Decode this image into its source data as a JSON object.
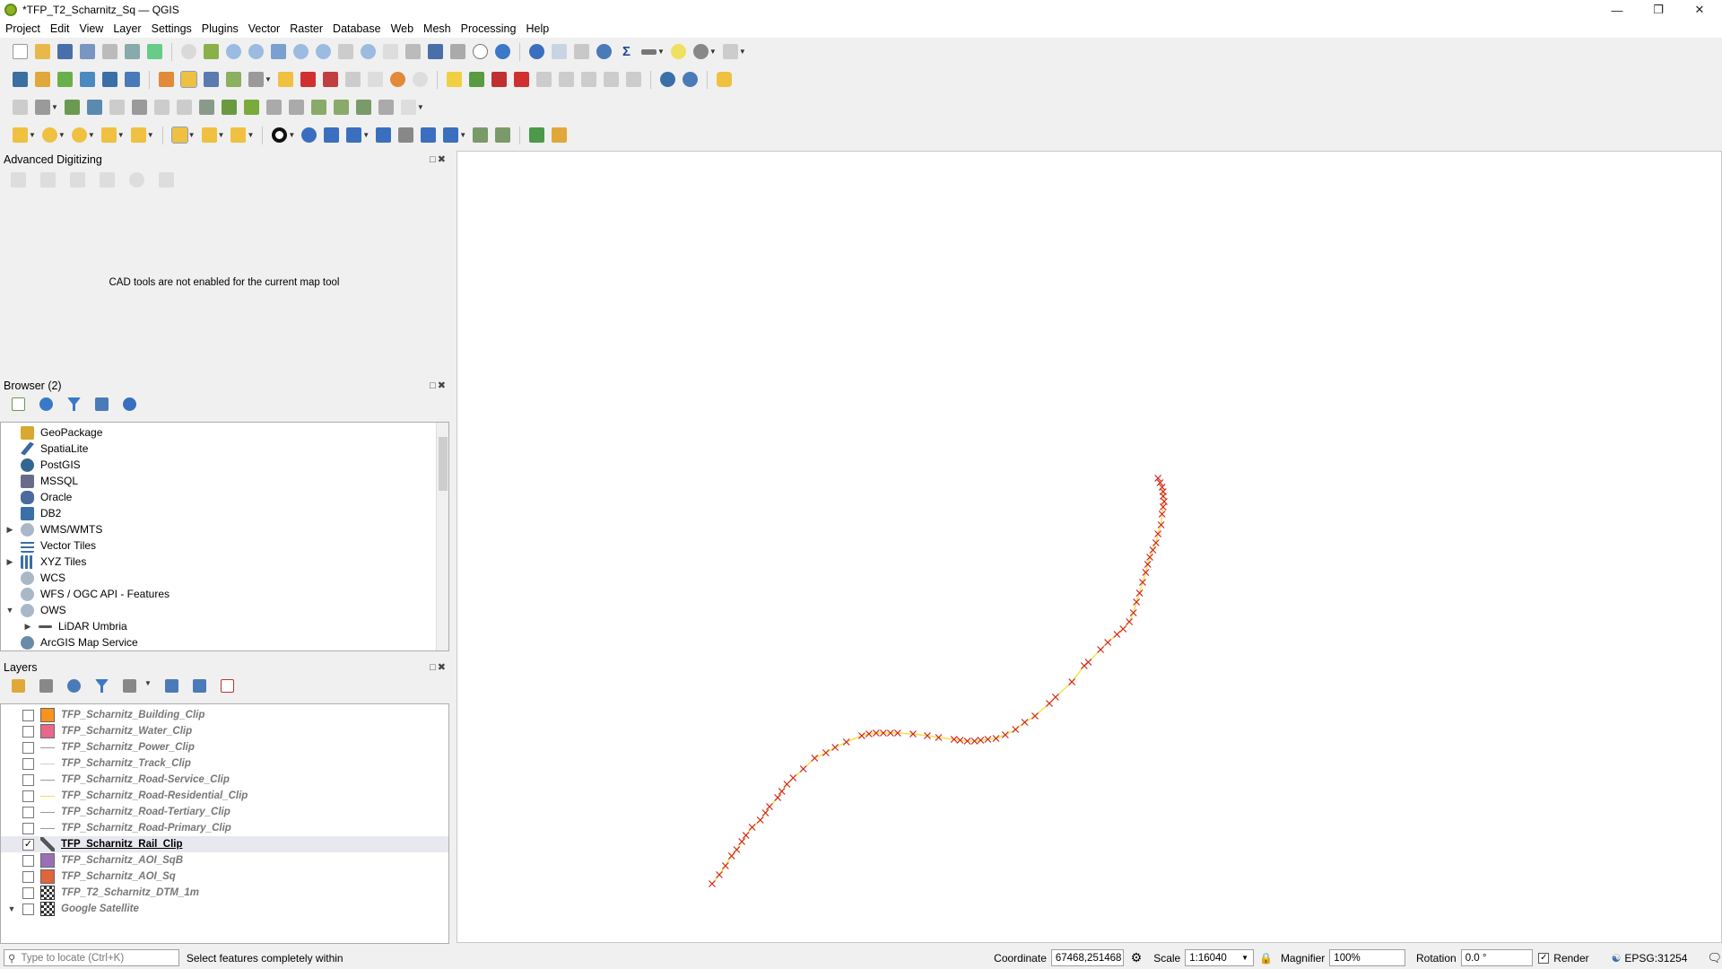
{
  "window": {
    "title": "*TFP_T2_Scharnitz_Sq — QGIS"
  },
  "menu": [
    "Project",
    "Edit",
    "View",
    "Layer",
    "Settings",
    "Plugins",
    "Vector",
    "Raster",
    "Database",
    "Web",
    "Mesh",
    "Processing",
    "Help"
  ],
  "advanced_digitizing": {
    "title": "Advanced Digitizing",
    "message": "CAD tools are not enabled for the current map tool"
  },
  "browser": {
    "title": "Browser (2)",
    "items": [
      {
        "label": "GeoPackage",
        "icon": "geopackage-icon"
      },
      {
        "label": "SpatiaLite",
        "icon": "spatialite-icon"
      },
      {
        "label": "PostGIS",
        "icon": "postgis-icon"
      },
      {
        "label": "MSSQL",
        "icon": "mssql-icon"
      },
      {
        "label": "Oracle",
        "icon": "oracle-icon"
      },
      {
        "label": "DB2",
        "icon": "db2-icon"
      },
      {
        "label": "WMS/WMTS",
        "icon": "globe-icon",
        "expand": "collapsed"
      },
      {
        "label": "Vector Tiles",
        "icon": "grid-icon"
      },
      {
        "label": "XYZ Tiles",
        "icon": "grid-icon",
        "expand": "collapsed"
      },
      {
        "label": "WCS",
        "icon": "globe-icon"
      },
      {
        "label": "WFS / OGC API - Features",
        "icon": "globe-icon"
      },
      {
        "label": "OWS",
        "icon": "globe-icon",
        "expand": "expanded"
      },
      {
        "label": "LiDAR Umbria",
        "icon": "connection-icon",
        "expand": "collapsed",
        "indent": 1
      },
      {
        "label": "ArcGIS Map Service",
        "icon": "globe-icon"
      }
    ]
  },
  "layers": {
    "title": "Layers",
    "items": [
      {
        "label": "TFP_Scharnitz_Building_Clip",
        "symbol": "fill",
        "color": "#f7931e",
        "checked": false
      },
      {
        "label": "TFP_Scharnitz_Water_Clip",
        "symbol": "fill",
        "color": "#e8688a",
        "checked": false
      },
      {
        "label": "TFP_Scharnitz_Power_Clip",
        "symbol": "line",
        "color": "#999999",
        "checked": false
      },
      {
        "label": "TFP_Scharnitz_Track_Clip",
        "symbol": "line",
        "color": "#cfcfcf",
        "checked": false
      },
      {
        "label": "TFP_Scharnitz_Road-Service_Clip",
        "symbol": "line",
        "color": "#999999",
        "checked": false
      },
      {
        "label": "TFP_Scharnitz_Road-Residential_Clip",
        "symbol": "line",
        "color": "#f0e14a",
        "checked": false
      },
      {
        "label": "TFP_Scharnitz_Road-Tertiary_Clip",
        "symbol": "line",
        "color": "#999999",
        "checked": false
      },
      {
        "label": "TFP_Scharnitz_Road-Primary_Clip",
        "symbol": "line",
        "color": "#999999",
        "checked": false
      },
      {
        "label": "TFP_Scharnitz_Rail_Clip",
        "symbol": "edit",
        "color": "#555555",
        "checked": true,
        "active": true
      },
      {
        "label": "TFP_Scharnitz_AOI_SqB",
        "symbol": "fill",
        "color": "#9b6fb5",
        "checked": false
      },
      {
        "label": "TFP_Scharnitz_AOI_Sq",
        "symbol": "fill",
        "color": "#e0643c",
        "checked": false
      },
      {
        "label": "TFP_T2_Scharnitz_DTM_1m",
        "symbol": "raster",
        "color": "#333333",
        "checked": false
      },
      {
        "label": "Google Satellite",
        "symbol": "raster",
        "color": "#333333",
        "checked": false,
        "expand": "expanded"
      }
    ]
  },
  "status": {
    "locate_placeholder": "Type to locate (Ctrl+K)",
    "message": "Select features completely within",
    "coordinate_label": "Coordinate",
    "coordinate_value": "67468,251468",
    "scale_label": "Scale",
    "scale_value": "1:16040",
    "magnifier_label": "Magnifier",
    "magnifier_value": "100%",
    "rotation_label": "Rotation",
    "rotation_value": "0.0 °",
    "render_label": "Render",
    "render_checked": true,
    "crs": "EPSG:31254"
  },
  "colors": {
    "rail_line": "#f2e24a",
    "vertex_marker": "#d62020",
    "map_background": "#ffffff"
  }
}
